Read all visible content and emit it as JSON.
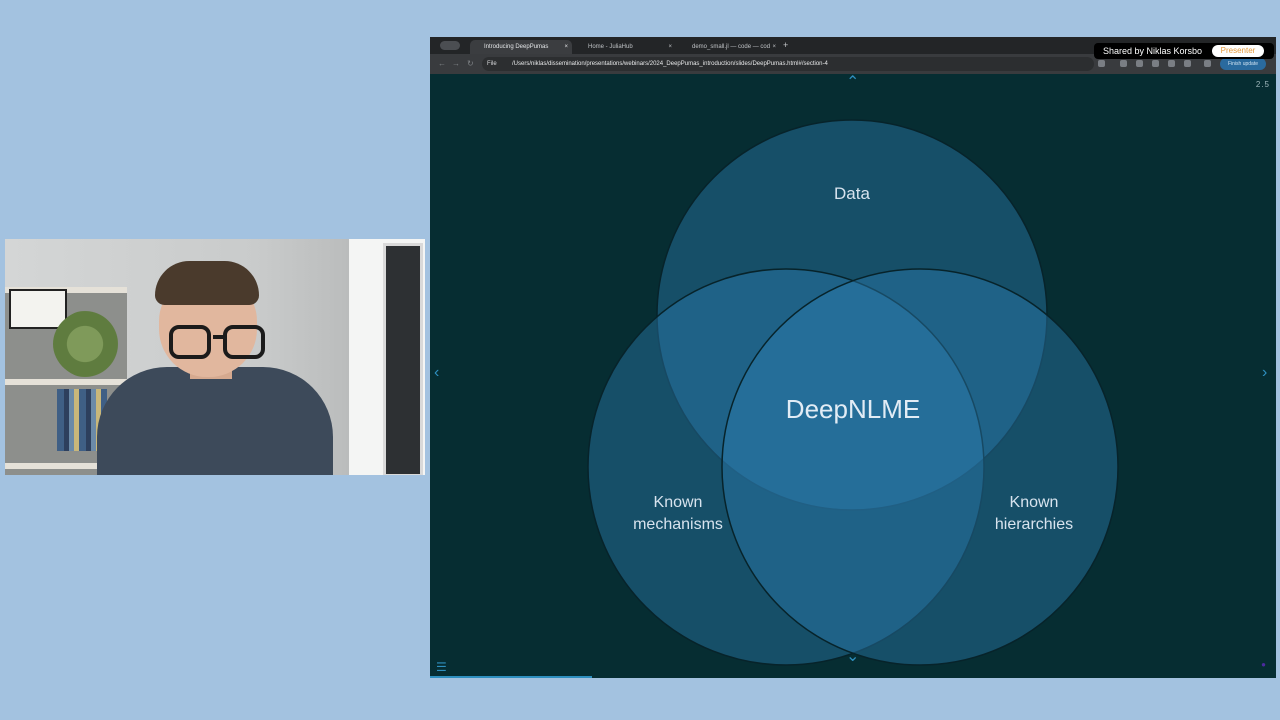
{
  "browser": {
    "tabs": [
      {
        "label": "Introducing DeepPumas",
        "active": true
      },
      {
        "label": "Home - JuliaHub",
        "active": false
      },
      {
        "label": "demo_small.jl — code — cod",
        "active": false
      }
    ],
    "close_glyph": "×",
    "new_tab_glyph": "+",
    "nav": {
      "back": "←",
      "forward": "→",
      "reload": "↻"
    },
    "url_scheme": "File",
    "url": "/Users/niklas/dissemination/presentations/webinars/2024_DeepPumas_introduction/slides/DeepPumas.html#/section-4",
    "update_button": "Finish update"
  },
  "sharing": {
    "label": "Shared by Niklas Korsbo",
    "badge": "Presenter"
  },
  "slide": {
    "number": "2.5",
    "venn": {
      "top": "Data",
      "left_line1": "Known",
      "left_line2": "mechanisms",
      "right_line1": "Known",
      "right_line2": "hierarchies",
      "center": "DeepNLME"
    },
    "controls": {
      "up": "⌃",
      "down": "⌄",
      "left": "‹",
      "right": "›",
      "menu": "☰"
    },
    "colors": {
      "background": "#062d32",
      "circle_fill": "#2e7fb3",
      "accent": "#2e8fbf"
    }
  }
}
